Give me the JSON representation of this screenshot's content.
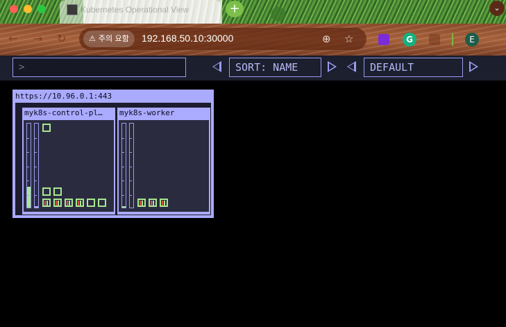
{
  "browser": {
    "tab_title": "Kubernetes Operational View",
    "new_tab": "+",
    "security_label": "주의 요함",
    "url": "192.168.50.10:30000",
    "avatar_initial": "E",
    "icons": [
      "back-icon",
      "forward-icon",
      "reload-icon",
      "warning-icon",
      "zoom-icon",
      "bookmark-star-icon",
      "extension-icon",
      "grammarly-icon",
      "extensions-puzzle-icon",
      "profile-avatar",
      "chevron-down-icon"
    ]
  },
  "app": {
    "filter": {
      "value": "",
      "placeholder": ">"
    },
    "sort": {
      "label": "SORT: NAME"
    },
    "theme": {
      "label": "DEFAULT"
    },
    "colors": {
      "accent": "#aaaaff",
      "pod_running": "#a8e890",
      "background": "#000000",
      "panel": "#2b2b40"
    },
    "cluster": {
      "api_url": "https://10.96.0.1:443",
      "nodes": [
        {
          "name": "myk8s-control-pl…",
          "gauges": [
            0.25,
            0.02
          ],
          "pods_top": 1,
          "pods_bottom_rows": [
            2,
            6
          ]
        },
        {
          "name": "myk8s-worker",
          "gauges": [
            0.02,
            0.0
          ],
          "pods_top": 0,
          "pods_bottom_rows": [
            3
          ]
        }
      ]
    }
  }
}
